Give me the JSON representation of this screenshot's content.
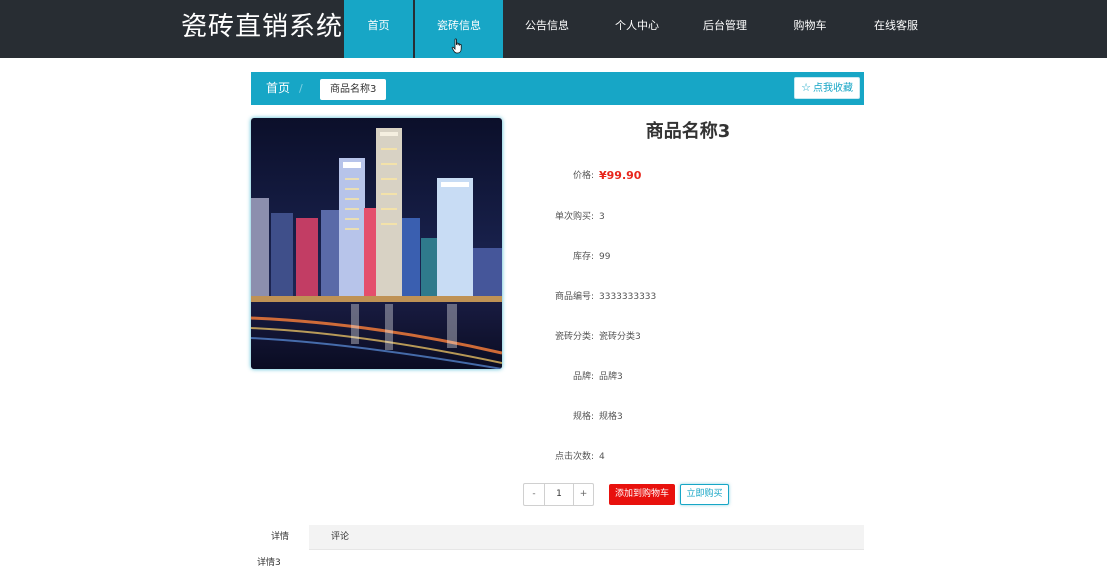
{
  "brand": {
    "name": "瓷砖直销系统"
  },
  "nav": {
    "items": [
      {
        "label": "首页"
      },
      {
        "label": "瓷砖信息"
      },
      {
        "label": "公告信息"
      },
      {
        "label": "个人中心"
      },
      {
        "label": "后台管理"
      },
      {
        "label": "购物车"
      },
      {
        "label": "在线客服"
      }
    ],
    "active": "首页",
    "hovered": "瓷砖信息"
  },
  "breadcrumb": {
    "home": "首页",
    "separator": "/",
    "current": "商品名称3",
    "favorite_label": "点我收藏",
    "favorite_icon": "star-outline-icon"
  },
  "product": {
    "title": "商品名称3",
    "image_alt": "night city skyline",
    "fields": [
      {
        "label": "价格:",
        "value": "¥99.90",
        "kind": "price"
      },
      {
        "label": "单次购买:",
        "value": "3"
      },
      {
        "label": "库存:",
        "value": "99"
      },
      {
        "label": "商品编号:",
        "value": "3333333333"
      },
      {
        "label": "瓷砖分类:",
        "value": "瓷砖分类3"
      },
      {
        "label": "品牌:",
        "value": "品牌3"
      },
      {
        "label": "规格:",
        "value": "规格3"
      },
      {
        "label": "点击次数:",
        "value": "4"
      }
    ]
  },
  "purchase": {
    "minus": "-",
    "quantity": "1",
    "plus": "+",
    "add_to_cart": "添加到购物车",
    "buy_now": "立即购买"
  },
  "tabs": {
    "items": [
      {
        "label": "详情"
      },
      {
        "label": "评论"
      }
    ],
    "active": "详情",
    "content": "详情3"
  },
  "colors": {
    "topbar": "#282d33",
    "accent": "#17a6c6",
    "price": "#e8251b",
    "cart_button": "#e8110d"
  }
}
